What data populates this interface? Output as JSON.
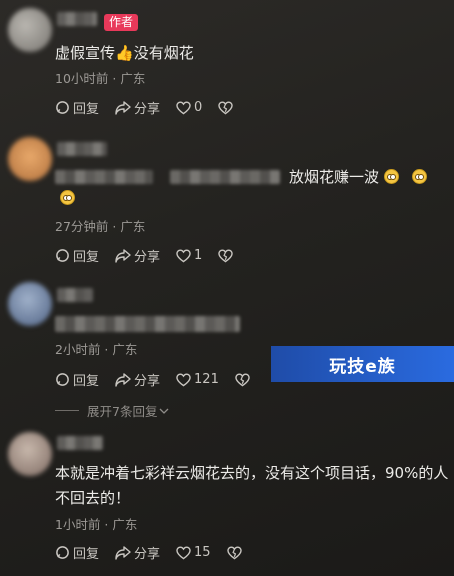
{
  "comments": [
    {
      "badge": "作者",
      "text": "虚假宣传",
      "text_after": "没有烟花",
      "meta": "10小时前 · 广东",
      "reply_label": "回复",
      "share_label": "分享",
      "likes": "0"
    },
    {
      "text": "放烟花赚一波",
      "meta": "27分钟前 · 广东",
      "reply_label": "回复",
      "share_label": "分享",
      "likes": "1"
    },
    {
      "meta": "2小时前 · 广东",
      "reply_label": "回复",
      "share_label": "分享",
      "likes": "121",
      "expand_label": "展开7条回复"
    },
    {
      "text_line1": "本就是冲着七彩祥云烟花去的，没有这个项目话，90%的人",
      "text_line2": "不回去的！",
      "meta": "1小时前 · 广东",
      "reply_label": "回复",
      "share_label": "分享",
      "likes": "15"
    }
  ],
  "watermark": "玩技e族",
  "colors": {
    "badge": "#e8395a",
    "watermark": "#2a6be0",
    "thumb": "#f2b23d"
  }
}
